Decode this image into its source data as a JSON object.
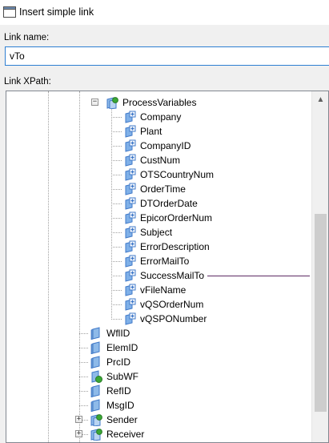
{
  "window": {
    "title": "Insert simple link"
  },
  "form": {
    "link_name_label": "Link name:",
    "link_name_value": "vTo",
    "link_xpath_label": "Link XPath:"
  },
  "tree": {
    "parent": {
      "label": "ProcessVariables",
      "icon": "folder-variables-icon",
      "expanded": true
    },
    "children": [
      {
        "label": "Company",
        "icon": "variable-add-icon"
      },
      {
        "label": "Plant",
        "icon": "variable-add-icon"
      },
      {
        "label": "CompanyID",
        "icon": "variable-add-icon"
      },
      {
        "label": "CustNum",
        "icon": "variable-add-icon"
      },
      {
        "label": "OTSCountryNum",
        "icon": "variable-add-icon"
      },
      {
        "label": "OrderTime",
        "icon": "variable-add-icon"
      },
      {
        "label": "DTOrderDate",
        "icon": "variable-add-icon"
      },
      {
        "label": "EpicorOrderNum",
        "icon": "variable-add-icon"
      },
      {
        "label": "Subject",
        "icon": "variable-add-icon"
      },
      {
        "label": "ErrorDescription",
        "icon": "variable-add-icon"
      },
      {
        "label": "ErrorMailTo",
        "icon": "variable-add-icon"
      },
      {
        "label": "SuccessMailTo",
        "icon": "variable-add-icon",
        "hovered": true
      },
      {
        "label": "vFileName",
        "icon": "variable-add-icon"
      },
      {
        "label": "vQSOrderNum",
        "icon": "variable-add-icon"
      },
      {
        "label": "vQSPONumber",
        "icon": "variable-add-icon"
      }
    ],
    "siblings": [
      {
        "label": "WflID",
        "icon": "field-icon",
        "expandable": false
      },
      {
        "label": "ElemID",
        "icon": "field-icon",
        "expandable": false
      },
      {
        "label": "PrcID",
        "icon": "field-icon",
        "expandable": false
      },
      {
        "label": "SubWF",
        "icon": "field-add-green-icon",
        "expandable": false
      },
      {
        "label": "RefID",
        "icon": "field-icon",
        "expandable": false
      },
      {
        "label": "MsgID",
        "icon": "field-icon",
        "expandable": false
      },
      {
        "label": "Sender",
        "icon": "folder-green-icon",
        "expandable": true
      },
      {
        "label": "Receiver",
        "icon": "folder-green-icon",
        "expandable": true
      }
    ]
  },
  "colors": {
    "accent_border": "#2e7fd2",
    "hover_line": "#5c2b63",
    "icon_blue": "#3f78c8",
    "icon_green": "#3aa836"
  }
}
